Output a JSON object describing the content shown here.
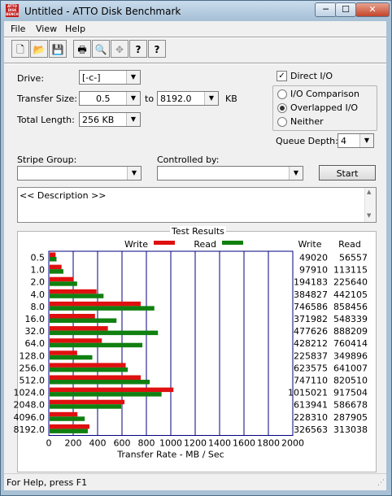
{
  "window": {
    "title": "Untitled - ATTO Disk Benchmark",
    "icon_text": "ATTO DISK BENCH",
    "min_label": "─",
    "max_label": "☐",
    "close_label": "✕"
  },
  "menu": {
    "file": "File",
    "view": "View",
    "help": "Help"
  },
  "toolbar": [
    {
      "name": "new-icon",
      "glyph": "🗋"
    },
    {
      "name": "open-icon",
      "glyph": "📂"
    },
    {
      "name": "save-icon",
      "glyph": "💾"
    },
    {
      "name": "print-icon",
      "glyph": "🖶"
    },
    {
      "name": "print-preview-icon",
      "glyph": "🔍"
    },
    {
      "name": "move-icon",
      "glyph": "✥"
    },
    {
      "name": "help-icon",
      "glyph": "?"
    },
    {
      "name": "whats-this-icon",
      "glyph": "?"
    }
  ],
  "form": {
    "drive_label": "Drive:",
    "drive_value": "[-c-]",
    "transfer_size_label": "Transfer Size:",
    "transfer_from": "0.5",
    "to_label": "to",
    "transfer_to": "8192.0",
    "kb_label": "KB",
    "total_length_label": "Total Length:",
    "total_length_value": "256 KB",
    "direct_io_label": "Direct I/O",
    "direct_io_checked": true,
    "radio_io_comparison": "I/O Comparison",
    "radio_overlapped": "Overlapped I/O",
    "radio_neither": "Neither",
    "selected_radio": "Overlapped I/O",
    "queue_depth_label": "Queue Depth:",
    "queue_depth_value": "4",
    "stripe_group_label": "Stripe Group:",
    "stripe_group_value": "",
    "controlled_by_label": "Controlled by:",
    "controlled_by_value": "",
    "start_label": "Start",
    "description": "<< Description >>"
  },
  "results": {
    "group_label": "Test Results",
    "legend_write": "Write",
    "legend_read": "Read",
    "col_write": "Write",
    "col_read": "Read"
  },
  "status": {
    "text": "For Help, press F1"
  },
  "chart_data": {
    "type": "bar",
    "orientation": "horizontal",
    "xlabel": "Transfer Rate - MB / Sec",
    "xlim": [
      0,
      2000
    ],
    "xticks": [
      0,
      200,
      400,
      600,
      800,
      1000,
      1200,
      1400,
      1600,
      1800,
      2000
    ],
    "grid": true,
    "legend_position": "top",
    "categories": [
      "0.5",
      "1.0",
      "2.0",
      "4.0",
      "8.0",
      "16.0",
      "32.0",
      "64.0",
      "128.0",
      "256.0",
      "512.0",
      "1024.0",
      "2048.0",
      "4096.0",
      "8192.0"
    ],
    "series": [
      {
        "name": "Write",
        "color": "#e01010",
        "values": [
          49020,
          97910,
          194183,
          384827,
          746586,
          371982,
          477626,
          428212,
          225837,
          623575,
          747110,
          1015021,
          613941,
          228310,
          326563
        ]
      },
      {
        "name": "Read",
        "color": "#108010",
        "values": [
          56557,
          113115,
          225640,
          442105,
          858456,
          548339,
          888209,
          760414,
          349896,
          641007,
          820510,
          917504,
          586678,
          287905,
          313038
        ]
      }
    ]
  }
}
